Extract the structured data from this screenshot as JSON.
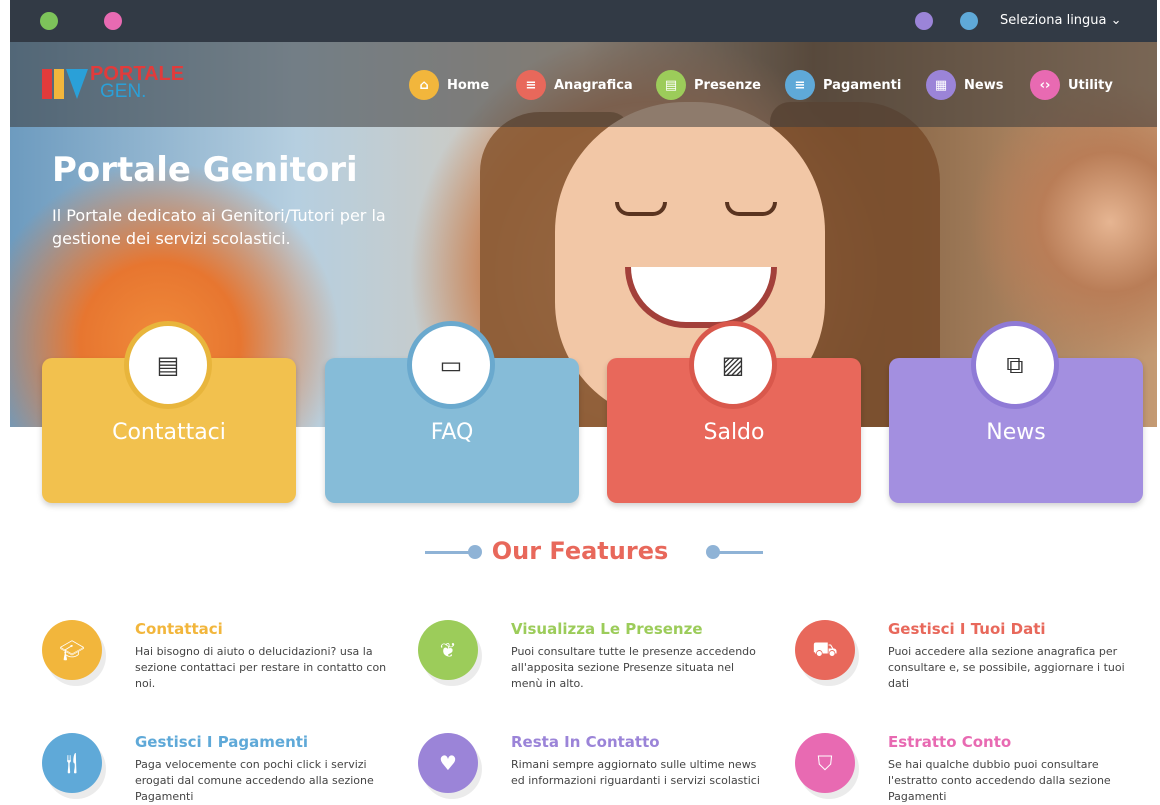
{
  "topbar": {
    "language_label": "Seleziona lingua",
    "icons": [
      "phone-icon",
      "clock-icon",
      "power-icon",
      "globe-icon"
    ]
  },
  "brand": {
    "line1": "PORTALE",
    "line2": "GEN."
  },
  "nav": [
    {
      "label": "Home",
      "color": "#f2b63c",
      "icon": "home-icon"
    },
    {
      "label": "Anagrafica",
      "color": "#e8685b",
      "icon": "list-icon"
    },
    {
      "label": "Presenze",
      "color": "#9ccc5a",
      "icon": "document-icon"
    },
    {
      "label": "Pagamenti",
      "color": "#5fa9d8",
      "icon": "list-icon"
    },
    {
      "label": "News",
      "color": "#9b84d8",
      "icon": "calendar-icon"
    },
    {
      "label": "Utility",
      "color": "#e86ab2",
      "icon": "code-icon"
    }
  ],
  "hero": {
    "title": "Portale Genitori",
    "subtitle": "Il Portale dedicato ai Genitori/Tutori per la gestione dei servizi scolastici."
  },
  "cards": [
    {
      "label": "Contattaci",
      "color": "#f2c14e",
      "ring": "#e8b53c",
      "icon": "document-icon"
    },
    {
      "label": "FAQ",
      "color": "#86bcd8",
      "ring": "#6aa9ce",
      "icon": "calendar-icon"
    },
    {
      "label": "Saldo",
      "color": "#e8685b",
      "ring": "#d9584c",
      "icon": "image-icon"
    },
    {
      "label": "News",
      "color": "#a38fe0",
      "ring": "#8f7ad6",
      "icon": "copy-icon"
    }
  ],
  "features_title": "Our Features",
  "features": [
    {
      "title": "Contattaci",
      "text": "Hai bisogno di aiuto o delucidazioni? usa la sezione contattaci per restare in contatto con noi.",
      "color": "#f2b63c",
      "icon": "graduation-cap-icon"
    },
    {
      "title": "Visualizza Le Presenze",
      "text": "Puoi consultare tutte le presenze accedendo all'apposita sezione Presenze situata nel menù in alto.",
      "color": "#9ccc5a",
      "icon": "leaf-icon"
    },
    {
      "title": "Gestisci I Tuoi Dati",
      "text": "Puoi accedere alla sezione anagrafica per consultare e, se possibile, aggiornare i tuoi dati",
      "color": "#e8685b",
      "icon": "car-icon"
    },
    {
      "title": "Gestisci I Pagamenti",
      "text": "Paga velocemente con pochi click i servizi erogati dal comune accedendo alla sezione Pagamenti",
      "color": "#5fa9d8",
      "icon": "cutlery-icon"
    },
    {
      "title": "Resta In Contatto",
      "text": "Rimani sempre aggiornato sulle ultime news ed informazioni riguardanti i servizi scolastici",
      "color": "#9b84d8",
      "icon": "heart-icon"
    },
    {
      "title": "Estratto Conto",
      "text": "Se hai qualche dubbio puoi consultare l'estratto conto accedendo dalla sezione Pagamenti",
      "color": "#e86ab2",
      "icon": "shield-icon"
    }
  ]
}
